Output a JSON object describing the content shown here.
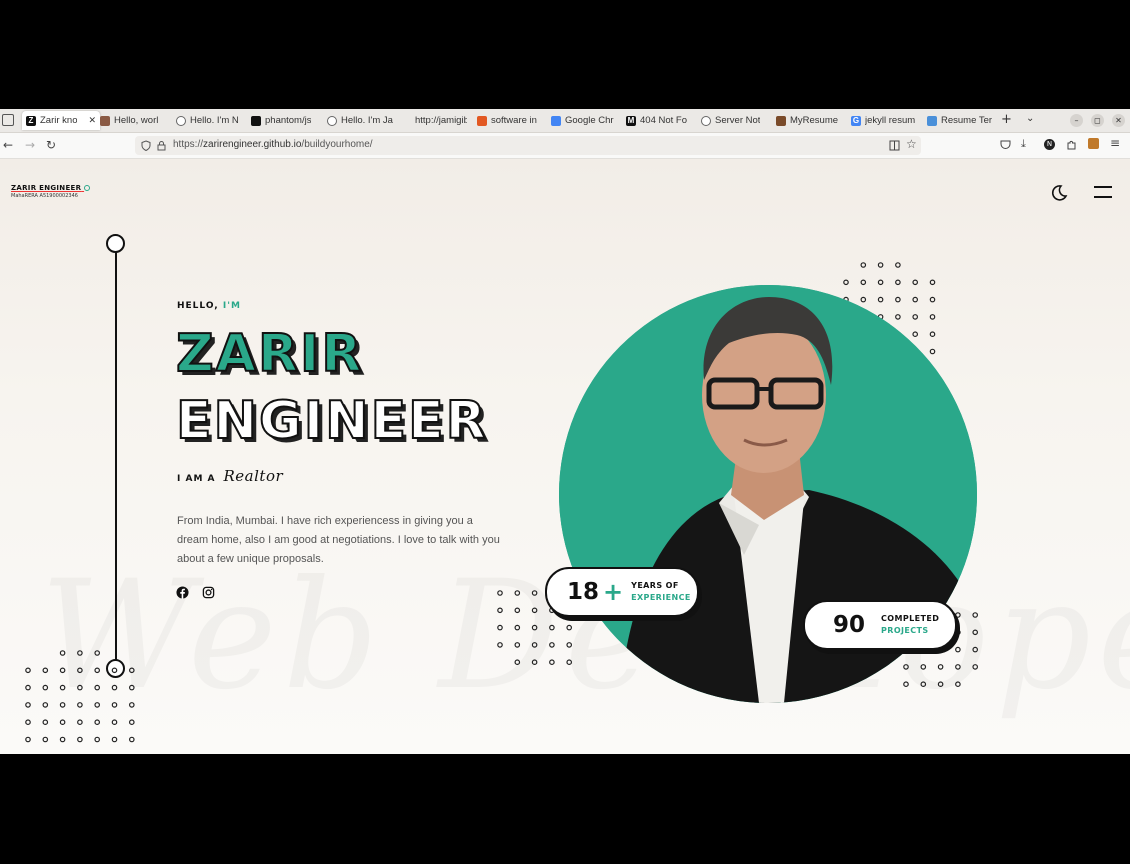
{
  "browser": {
    "tabs": [
      {
        "title": "Zarir kno",
        "favicon": "Z",
        "color": "#111111",
        "active": true
      },
      {
        "title": "Hello, worl",
        "favicon": "",
        "color": "#8a5a44",
        "active": false
      },
      {
        "title": "Hello. I'm N",
        "favicon": "",
        "color": "#ffffff",
        "active": false
      },
      {
        "title": "phantom/js",
        "favicon": "",
        "color": "#111111",
        "active": false
      },
      {
        "title": "Hello. I'm Ja",
        "favicon": "",
        "color": "#ffffff",
        "active": false
      },
      {
        "title": "http://jamigibb",
        "favicon": "",
        "color": "",
        "active": false
      },
      {
        "title": "software in",
        "favicon": "",
        "color": "#e25822",
        "active": false
      },
      {
        "title": "Google Chr",
        "favicon": "",
        "color": "#4285f4",
        "active": false
      },
      {
        "title": "404 Not Fo",
        "favicon": "M",
        "color": "#111111",
        "active": false
      },
      {
        "title": "Server Not",
        "favicon": "",
        "color": "#ffffff",
        "active": false
      },
      {
        "title": "MyResume",
        "favicon": "",
        "color": "#7a4b2a",
        "active": false
      },
      {
        "title": "jekyll resum",
        "favicon": "G",
        "color": "#4285f4",
        "active": false
      },
      {
        "title": "Resume Ter",
        "favicon": "",
        "color": "#4a90d9",
        "active": false
      }
    ],
    "url_prefix": "https://",
    "url_domain": "zarirengineer.github.io",
    "url_path": "/buildyourhome/"
  },
  "site": {
    "logo_title": "ZARIR ENGINEER",
    "logo_sub": "MahaRERA A51900002346",
    "watermark": "Web Developer"
  },
  "hero": {
    "hello": "HELLO,",
    "im": "I'M",
    "first_name": "ZARIR",
    "last_name": "ENGINEER",
    "iam": "I AM A",
    "role": "Realtor",
    "description": "From India, Mumbai. I have rich experiencess in giving you a dream home, also I am good at negotiations. I love to talk with you about a few unique proposals."
  },
  "stats": {
    "years_value": "18",
    "years_plus": "+",
    "years_label_1": "YEARS OF",
    "years_label_2": "EXPERIENCE",
    "projects_value": "90",
    "projects_label_1": "COMPLETED",
    "projects_label_2": "PROJECTS"
  },
  "colors": {
    "accent": "#2aa88a",
    "dark": "#111111"
  }
}
